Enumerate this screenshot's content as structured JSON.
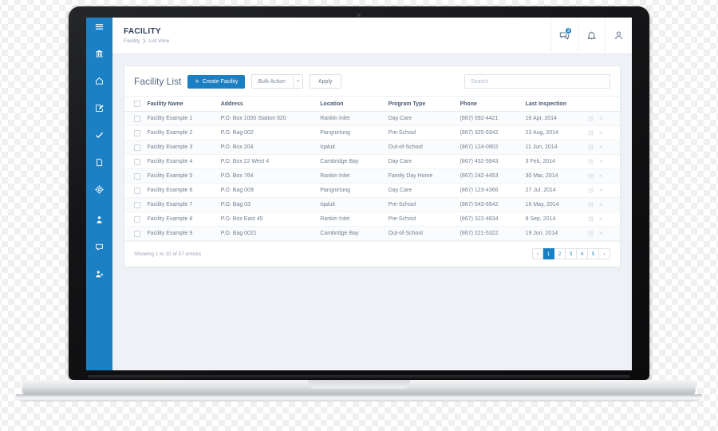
{
  "window": {
    "device": "laptop-mockup"
  },
  "sidebar": {
    "menu_toggle": "hamburger-menu",
    "items": [
      {
        "icon": "bank-building-icon",
        "name": "sidebar-item-facility"
      },
      {
        "icon": "home-icon",
        "name": "sidebar-item-home"
      },
      {
        "icon": "edit-document-icon",
        "name": "sidebar-item-edit"
      },
      {
        "icon": "check-icon",
        "name": "sidebar-item-tasks"
      },
      {
        "icon": "file-icon",
        "name": "sidebar-item-files"
      },
      {
        "icon": "gear-icon",
        "name": "sidebar-item-settings"
      },
      {
        "icon": "user-icon",
        "name": "sidebar-item-profile"
      },
      {
        "icon": "chat-icon",
        "name": "sidebar-item-messages"
      },
      {
        "icon": "add-user-icon",
        "name": "sidebar-item-add-user"
      }
    ]
  },
  "topbar": {
    "title": "FACILITY",
    "breadcrumb": {
      "parent": "Facility",
      "separator": "❯",
      "current": "List View"
    },
    "messages_badge": "3",
    "icons": {
      "messages": "message-icon",
      "notifications": "bell-icon",
      "account": "user-account-icon"
    }
  },
  "toolbar": {
    "list_title": "Facility List",
    "create_label": "Create Facility",
    "create_plus": "+",
    "bulk_action_label": "Bulk Action",
    "bulk_action_caret": "▾",
    "apply_label": "Apply",
    "search_placeholder": "Search",
    "search_value": ""
  },
  "table": {
    "columns": [
      "Facility Name",
      "Address",
      "Location",
      "Program Type",
      "Phone",
      "Last Inspection"
    ],
    "rows": [
      {
        "name": "Facility Example 1",
        "address": "P.O. Box 1000 Station 920",
        "location": "Rankin Inlet",
        "program": "Day Care",
        "phone": "(867) 592-4421",
        "inspection": "18 Apr, 2014"
      },
      {
        "name": "Facility Example 2",
        "address": "P.O. Bag 002",
        "location": "Pangnirtung",
        "program": "Pre-School",
        "phone": "(867) 325-9342",
        "inspection": "23 Aug, 2014"
      },
      {
        "name": "Facility Example 3",
        "address": "P.O. Box 204",
        "location": "Iqaluit",
        "program": "Out-of-School",
        "phone": "(867) 124-0902",
        "inspection": "11 Jun, 2014"
      },
      {
        "name": "Facility Example 4",
        "address": "P.O. Box 22 West 4",
        "location": "Cambridge Bay",
        "program": "Day Care",
        "phone": "(867) 452-5943",
        "inspection": "3 Feb, 2014"
      },
      {
        "name": "Facility Example 5",
        "address": "P.O. Box 764",
        "location": "Rankin Inlet",
        "program": "Family Day Home",
        "phone": "(867) 242-4453",
        "inspection": "30 Mar, 2014"
      },
      {
        "name": "Facility Example 6",
        "address": "P.O. Bag 009",
        "location": "Pangnirtung",
        "program": "Day Care",
        "phone": "(867) 123-4366",
        "inspection": "27 Jul, 2014"
      },
      {
        "name": "Facility Example 7",
        "address": "P.O. Bag 03",
        "location": "Iqaluit",
        "program": "Pre-School",
        "phone": "(867) 543-6542",
        "inspection": "16 May, 2014"
      },
      {
        "name": "Facility Example 8",
        "address": "P.O. Box East 45",
        "location": "Rankin Inlet",
        "program": "Pre-School",
        "phone": "(867) 322-4834",
        "inspection": "8 Sep, 2014"
      },
      {
        "name": "Facility Example 9",
        "address": "P.O. Bag 0021",
        "location": "Cambridge Bay",
        "program": "Out-of-School",
        "phone": "(867) 221-5322",
        "inspection": "19 Jun, 2014"
      }
    ],
    "row_actions": {
      "edit": "edit-icon",
      "delete": "×"
    }
  },
  "footer": {
    "entries_info": "Showing 1 to 10 of 57 entries",
    "pagination": {
      "prev": "‹",
      "next": "›",
      "pages": [
        "1",
        "2",
        "3",
        "4",
        "5"
      ],
      "active": "1"
    }
  },
  "colors": {
    "accent": "#1b7fc4",
    "sidebar": "#1b81c4",
    "page_bg": "#eef2f7",
    "title_text": "#2e3f5c"
  }
}
